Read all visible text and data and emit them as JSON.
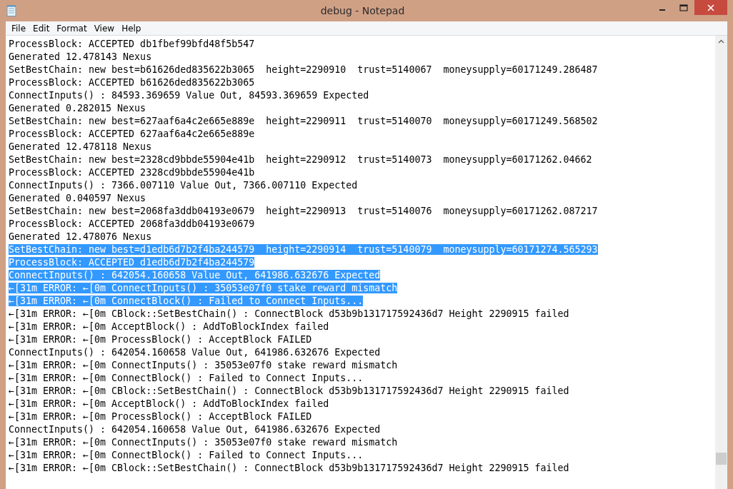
{
  "window": {
    "title": "debug - Notepad"
  },
  "menu": [
    "File",
    "Edit",
    "Format",
    "View",
    "Help"
  ],
  "lines": [
    {
      "text": "ProcessBlock: ACCEPTED db1fbef99bfd48f5b547",
      "selected": false
    },
    {
      "text": "Generated 12.478143 Nexus",
      "selected": false
    },
    {
      "text": "SetBestChain: new best=b61626ded835622b3065  height=2290910  trust=5140067  moneysupply=60171249.286487",
      "selected": false
    },
    {
      "text": "ProcessBlock: ACCEPTED b61626ded835622b3065",
      "selected": false
    },
    {
      "text": "ConnectInputs() : 84593.369659 Value Out, 84593.369659 Expected",
      "selected": false
    },
    {
      "text": "Generated 0.282015 Nexus",
      "selected": false
    },
    {
      "text": "SetBestChain: new best=627aaf6a4c2e665e889e  height=2290911  trust=5140070  moneysupply=60171249.568502",
      "selected": false
    },
    {
      "text": "ProcessBlock: ACCEPTED 627aaf6a4c2e665e889e",
      "selected": false
    },
    {
      "text": "Generated 12.478118 Nexus",
      "selected": false
    },
    {
      "text": "SetBestChain: new best=2328cd9bbde55904e41b  height=2290912  trust=5140073  moneysupply=60171262.04662",
      "selected": false
    },
    {
      "text": "ProcessBlock: ACCEPTED 2328cd9bbde55904e41b",
      "selected": false
    },
    {
      "text": "ConnectInputs() : 7366.007110 Value Out, 7366.007110 Expected",
      "selected": false
    },
    {
      "text": "Generated 0.040597 Nexus",
      "selected": false
    },
    {
      "text": "SetBestChain: new best=2068fa3ddb04193e0679  height=2290913  trust=5140076  moneysupply=60171262.087217",
      "selected": false
    },
    {
      "text": "ProcessBlock: ACCEPTED 2068fa3ddb04193e0679",
      "selected": false
    },
    {
      "text": "Generated 12.478076 Nexus",
      "selected": false
    },
    {
      "text": "SetBestChain: new best=d1edb6d7b2f4ba244579  height=2290914  trust=5140079  moneysupply=60171274.565293",
      "selected": true
    },
    {
      "text": "ProcessBlock: ACCEPTED d1edb6d7b2f4ba244579",
      "selected": true
    },
    {
      "text": "ConnectInputs() : 642054.160658 Value Out, 641986.632676 Expected",
      "selected": true
    },
    {
      "text": "←[31m ERROR: ←[0m ConnectInputs() : 35053e07f0 stake reward mismatch",
      "selected": true
    },
    {
      "text": "←[31m ERROR: ←[0m ConnectBlock() : Failed to Connect Inputs...",
      "selected": true
    },
    {
      "text": "←[31m ERROR: ←[0m CBlock::SetBestChain() : ConnectBlock d53b9b131717592436d7 Height 2290915 failed",
      "selected": false
    },
    {
      "text": "←[31m ERROR: ←[0m AcceptBlock() : AddToBlockIndex failed",
      "selected": false
    },
    {
      "text": "←[31m ERROR: ←[0m ProcessBlock() : AcceptBlock FAILED",
      "selected": false
    },
    {
      "text": "ConnectInputs() : 642054.160658 Value Out, 641986.632676 Expected",
      "selected": false
    },
    {
      "text": "←[31m ERROR: ←[0m ConnectInputs() : 35053e07f0 stake reward mismatch",
      "selected": false
    },
    {
      "text": "←[31m ERROR: ←[0m ConnectBlock() : Failed to Connect Inputs...",
      "selected": false
    },
    {
      "text": "←[31m ERROR: ←[0m CBlock::SetBestChain() : ConnectBlock d53b9b131717592436d7 Height 2290915 failed",
      "selected": false
    },
    {
      "text": "←[31m ERROR: ←[0m AcceptBlock() : AddToBlockIndex failed",
      "selected": false
    },
    {
      "text": "←[31m ERROR: ←[0m ProcessBlock() : AcceptBlock FAILED",
      "selected": false
    },
    {
      "text": "ConnectInputs() : 642054.160658 Value Out, 641986.632676 Expected",
      "selected": false
    },
    {
      "text": "←[31m ERROR: ←[0m ConnectInputs() : 35053e07f0 stake reward mismatch",
      "selected": false
    },
    {
      "text": "←[31m ERROR: ←[0m ConnectBlock() : Failed to Connect Inputs...",
      "selected": false
    },
    {
      "text": "←[31m ERROR: ←[0m CBlock::SetBestChain() : ConnectBlock d53b9b131717592436d7 Height 2290915 failed",
      "selected": false
    }
  ]
}
